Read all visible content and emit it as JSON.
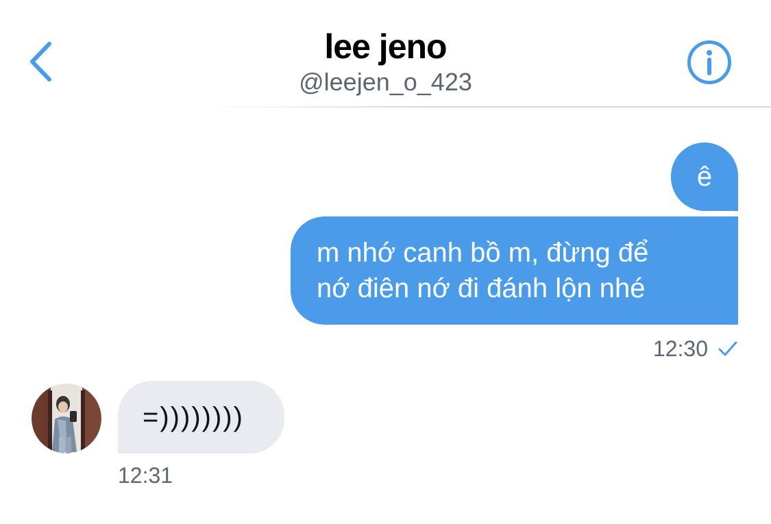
{
  "header": {
    "title": "lee jeno",
    "handle": "@leejen_o_423",
    "back_icon": "chevron-left-icon",
    "info_icon": "info-circle-icon",
    "accent_color": "#4a9be8"
  },
  "messages": [
    {
      "direction": "outgoing",
      "text": "ê"
    },
    {
      "direction": "outgoing",
      "text": "m nhớ canh bồ m, đừng để\nnớ điên nớ đi đánh lộn nhé",
      "time": "12:30",
      "status_icon": "checkmark-icon"
    },
    {
      "direction": "incoming",
      "text": "=))))))))",
      "time": "12:31",
      "avatar_icon": "avatar"
    }
  ],
  "colors": {
    "outgoing_bubble": "#4a9be8",
    "incoming_bubble": "#e9ebf0",
    "meta_text": "#5b6670"
  }
}
